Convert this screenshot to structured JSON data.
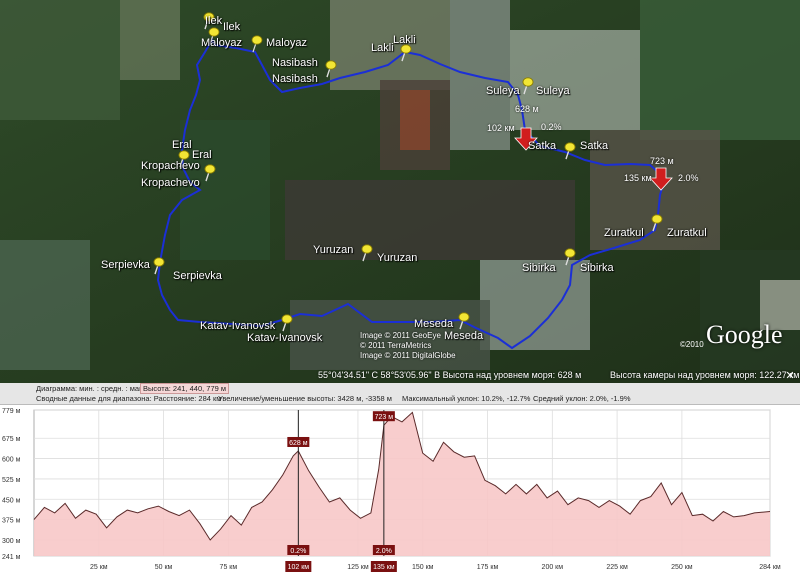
{
  "map": {
    "places": [
      {
        "name": "Ilek",
        "label": "Ilek"
      },
      {
        "name": "Maloyaz",
        "label": "Maloyaz"
      },
      {
        "name": "Maloyaz",
        "label": "Maloyaz"
      },
      {
        "name": "Nasibash",
        "label": "Nasibash"
      },
      {
        "name": "Nasibash",
        "label": "Nasibash"
      },
      {
        "name": "Lakli",
        "label": "Lakli"
      },
      {
        "name": "Lakli",
        "label": "Lakli"
      },
      {
        "name": "Suleya",
        "label": "Suleya"
      },
      {
        "name": "Suleya",
        "label": "Suleya"
      },
      {
        "name": "Satka",
        "label": "Satka"
      },
      {
        "name": "Satka",
        "label": "Satka"
      },
      {
        "name": "Eral",
        "label": "Eral"
      },
      {
        "name": "Eral",
        "label": "Eral"
      },
      {
        "name": "Kropachevo",
        "label": "Kropachevo"
      },
      {
        "name": "Kropachevo",
        "label": "Kropachevo"
      },
      {
        "name": "Zuratkul",
        "label": "Zuratkul"
      },
      {
        "name": "Zuratkul",
        "label": "Zuratkul"
      },
      {
        "name": "Sibirka",
        "label": "Sibirka"
      },
      {
        "name": "Sibirka",
        "label": "Sibirka"
      },
      {
        "name": "Yuruzan",
        "label": "Yuruzan"
      },
      {
        "name": "Yuruzan",
        "label": "Yuruzan"
      },
      {
        "name": "Serpievka",
        "label": "Serpievka"
      },
      {
        "name": "Serpievka",
        "label": "Serpievka"
      },
      {
        "name": "Katav-Ivanovsk",
        "label": "Katav-Ivanovsk"
      },
      {
        "name": "Katav-Ivanovsk",
        "label": "Katav-Ivanovsk"
      },
      {
        "name": "Meseda",
        "label": "Meseda"
      },
      {
        "name": "Meseda",
        "label": "Meseda"
      },
      {
        "name": "Ilek",
        "label": "Ilek"
      }
    ],
    "route_notes": {
      "elev_628": "628 м",
      "dist_102": "102 км",
      "slope_02": "0.2%",
      "elev_723": "723 м",
      "dist_135": "135 км",
      "slope_20": "2.0%"
    },
    "copyright_lines": [
      "Image © 2011 GeoEye",
      "© 2011 TerraMetrics",
      "Image © 2011 DigitalGlobe"
    ],
    "copyright_2010": "©2010",
    "logo": "Google",
    "status_coords": "55°04'34.51\" С   58°53'05.96\" В  Высота над уровнем моря:   628 м",
    "status_camera": "Высота камеры над уровнем моря:   122.27 км",
    "close_symbol": "✕",
    "route_color": "#1b2fd6",
    "marker_color": "#d11e1e"
  },
  "profile": {
    "header_row1": {
      "prefix": "Диаграмма: мин. : средн. : макс.:",
      "highlight": "Высота: 241, 440, 779 м"
    },
    "header_row2": {
      "summary": "Сводные данные для диапазона:   Расстояние: 284 км",
      "zoom": "Увеличение/уменьшение высоты: 3428 м, -3358 м",
      "max_slope": "Максимальный уклон: 10.2%, -12.7%",
      "avg_slope": "Средний уклон: 2.0%, -1.9%"
    },
    "fill_color": "#f7c8c8",
    "line_color": "#5a2a2a",
    "marker_box_color": "#7a1010"
  },
  "chart_data": {
    "type": "area",
    "xlabel": "",
    "ylabel": "",
    "xlim": [
      0,
      284
    ],
    "ylim": [
      241,
      779
    ],
    "x_ticks": [
      {
        "value": 25,
        "label": "25 км"
      },
      {
        "value": 50,
        "label": "50 км"
      },
      {
        "value": 75,
        "label": "75 км"
      },
      {
        "value": 102,
        "label": "102 км"
      },
      {
        "value": 125,
        "label": "125 км"
      },
      {
        "value": 135,
        "label": "135 км"
      },
      {
        "value": 150,
        "label": "150 км"
      },
      {
        "value": 175,
        "label": "175 км"
      },
      {
        "value": 200,
        "label": "200 км"
      },
      {
        "value": 225,
        "label": "225 км"
      },
      {
        "value": 250,
        "label": "250 км"
      },
      {
        "value": 284,
        "label": "284 км"
      }
    ],
    "y_ticks": [
      {
        "value": 241,
        "label": "241 м"
      },
      {
        "value": 300,
        "label": "300 м"
      },
      {
        "value": 375,
        "label": "375 м"
      },
      {
        "value": 450,
        "label": "450 м"
      },
      {
        "value": 525,
        "label": "525 м"
      },
      {
        "value": 600,
        "label": "600 м"
      },
      {
        "value": 675,
        "label": "675 м"
      },
      {
        "value": 779,
        "label": "779 м"
      }
    ],
    "grid": true,
    "series": [
      {
        "x": [
          0,
          4,
          8,
          12,
          16,
          20,
          24,
          28,
          32,
          36,
          40,
          44,
          48,
          52,
          56,
          60,
          64,
          68,
          72,
          76,
          80,
          84,
          88,
          92,
          96,
          100,
          102,
          106,
          110,
          114,
          118,
          122,
          126,
          130,
          133,
          135,
          138,
          142,
          146,
          150,
          154,
          158,
          162,
          166,
          170,
          174,
          178,
          182,
          186,
          190,
          194,
          198,
          202,
          206,
          210,
          214,
          218,
          222,
          226,
          230,
          234,
          238,
          242,
          246,
          250,
          254,
          258,
          262,
          266,
          270,
          274,
          278,
          284
        ],
        "y": [
          375,
          420,
          400,
          435,
          380,
          410,
          395,
          345,
          385,
          410,
          400,
          415,
          425,
          405,
          390,
          410,
          360,
          300,
          340,
          390,
          355,
          420,
          440,
          485,
          540,
          610,
          628,
          555,
          495,
          440,
          455,
          410,
          380,
          400,
          560,
          723,
          755,
          735,
          770,
          620,
          590,
          660,
          625,
          605,
          610,
          520,
          500,
          470,
          505,
          470,
          505,
          455,
          480,
          430,
          455,
          445,
          420,
          445,
          425,
          395,
          445,
          460,
          510,
          430,
          475,
          390,
          395,
          370,
          405,
          385,
          390,
          400,
          405
        ]
      }
    ],
    "markers": [
      {
        "x": 102,
        "value_label": "628 м",
        "slope_label": "0.2%"
      },
      {
        "x": 135,
        "value_label": "723 м",
        "slope_label": "2.0%"
      }
    ]
  }
}
